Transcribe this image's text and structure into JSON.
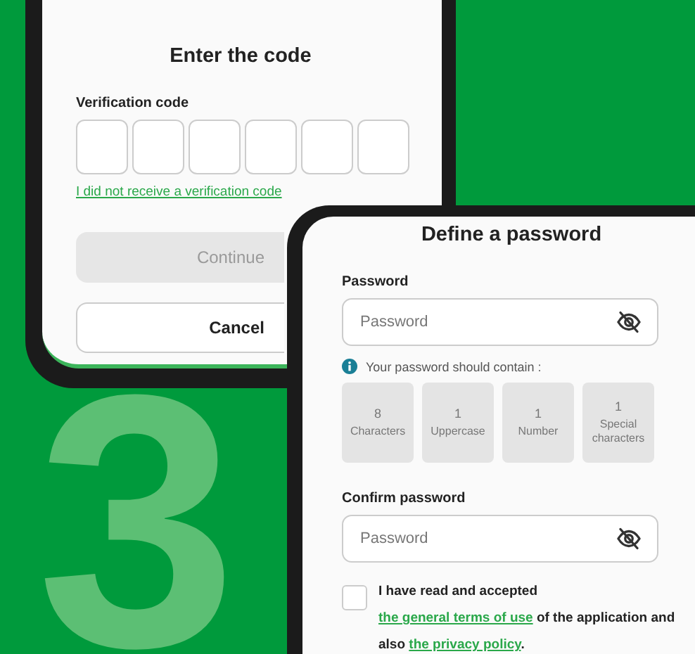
{
  "step_number": "3",
  "code_screen": {
    "title": "Enter the code",
    "field_label": "Verification code",
    "code_boxes": [
      {
        "filled": false
      },
      {
        "filled": false
      },
      {
        "filled": false
      },
      {
        "filled": false
      },
      {
        "filled": false
      },
      {
        "filled": false
      }
    ],
    "resend_link": "I did not receive a verification code",
    "buttons": [
      {
        "label": "Continue",
        "disabled": true
      },
      {
        "label": "Cancel",
        "disabled": false
      }
    ]
  },
  "password_screen": {
    "title": "Define a password",
    "password": {
      "label": "Password",
      "placeholder": "Password"
    },
    "hint": "Your password should contain :",
    "requirements": [
      {
        "count": "8",
        "label": "Characters"
      },
      {
        "count": "1",
        "label": "Uppercase"
      },
      {
        "count": "1",
        "label": "Number"
      },
      {
        "count": "1",
        "label": "Special characters"
      }
    ],
    "confirm": {
      "label": "Confirm password",
      "placeholder": "Password"
    },
    "terms": {
      "checked": false,
      "parts": [
        {
          "kind": "text",
          "text": "I have read and accepted"
        },
        {
          "kind": "link",
          "text": "the general terms of use"
        },
        {
          "kind": "text",
          "text": " of the application and also "
        },
        {
          "kind": "link",
          "text": "the privacy policy"
        },
        {
          "kind": "text",
          "text": "."
        }
      ]
    }
  }
}
